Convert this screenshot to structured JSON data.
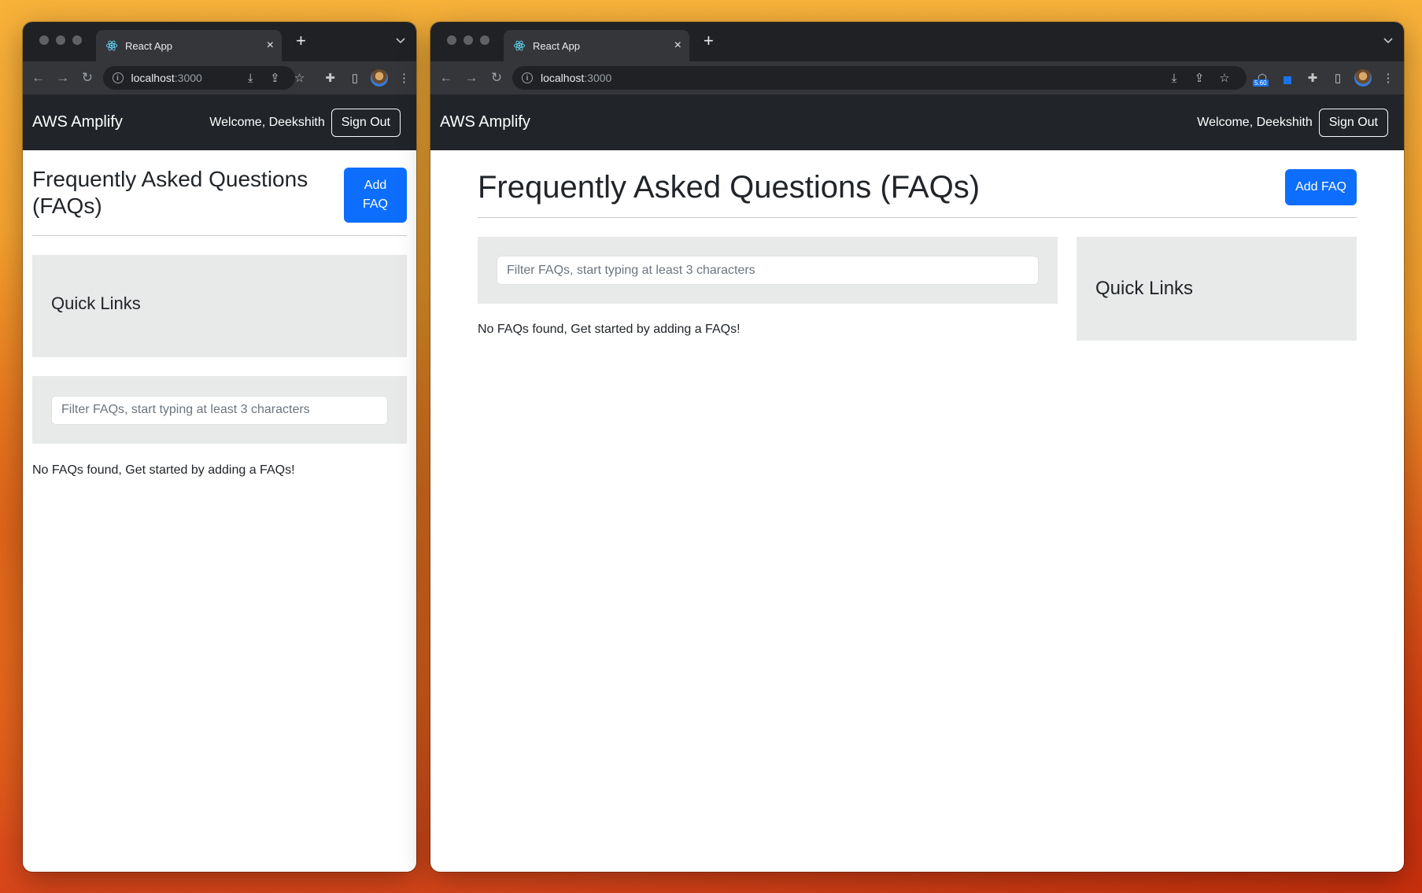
{
  "browser": {
    "tab_title": "React App",
    "tab_close": "×",
    "new_tab": "+",
    "tab_menu": "⌄",
    "url_host": "localhost",
    "url_port": ":3000",
    "ext_badge": "5.60"
  },
  "app": {
    "brand": "AWS Amplify",
    "welcome": "Welcome, Deekshith",
    "sign_out": "Sign Out",
    "page_title": "Frequently Asked Questions (FAQs)",
    "add_faq": "Add FAQ",
    "quick_links": "Quick Links",
    "filter_placeholder": "Filter FAQs, start typing at least 3 characters",
    "empty_message": "No FAQs found, Get started by adding a FAQs!"
  },
  "icons": {
    "back": "back-arrow-icon",
    "forward": "forward-arrow-icon",
    "reload": "reload-icon",
    "info": "site-info-icon",
    "install": "install-icon",
    "share": "share-icon",
    "bookmark": "star-icon",
    "extensions": "puzzle-icon",
    "sidepanel": "side-panel-icon",
    "profile": "avatar",
    "menu": "kebab-menu-icon",
    "favicon": "react-icon"
  },
  "colors": {
    "navbar": "#212529",
    "primary": "#0d6efd",
    "panel": "#e8e9e9",
    "chrome_dark": "#202124",
    "chrome_toolbar": "#35363a"
  }
}
